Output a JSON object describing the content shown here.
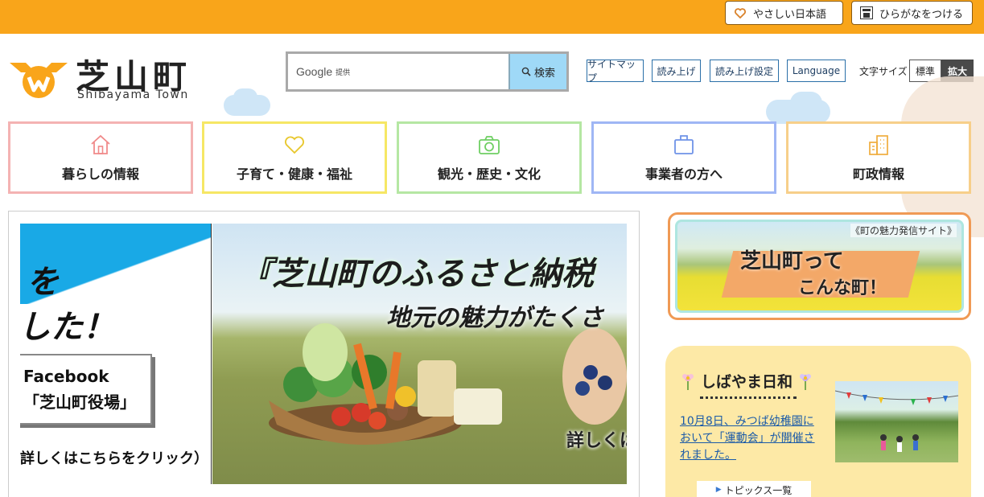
{
  "topbar": {
    "yasashii_label": "やさしい日本語",
    "hiragana_label": "ひらがなをつける",
    "hiragana_icon_text": "ふり\n仮名"
  },
  "header": {
    "logo_title": "芝山町",
    "logo_subtitle": "Shibayama Town",
    "search": {
      "google_label": "Google",
      "provided_label": "提供",
      "button_label": "検索"
    },
    "utility": {
      "sitemap": "サイトマップ",
      "read_aloud": "読み上げ",
      "read_aloud_settings": "読み上げ設定",
      "language": "Language"
    },
    "fontsize": {
      "label": "文字サイズ",
      "standard": "標準",
      "large": "拡大"
    }
  },
  "nav": [
    {
      "label": "暮らしの情報",
      "icon": "house-icon",
      "color": "#f4b3b3"
    },
    {
      "label": "子育て・健康・福祉",
      "icon": "heart-icon",
      "color": "#f6e765"
    },
    {
      "label": "観光・歴史・文化",
      "icon": "camera-icon",
      "color": "#b5e7a3"
    },
    {
      "label": "事業者の方へ",
      "icon": "briefcase-icon",
      "color": "#9fb6f5"
    },
    {
      "label": "町政情報",
      "icon": "building-icon",
      "color": "#f7cf8a"
    }
  ],
  "banner": {
    "left": {
      "line1": "を",
      "line2": "した！",
      "fb_line1": "Facebook",
      "fb_line2": "「芝山町役場」",
      "click_text": "詳しくはこちらをクリック）"
    },
    "right": {
      "title": "『芝山町のふるさと納税",
      "subtitle": "地元の魅力がたくさ",
      "more": "詳しくは"
    }
  },
  "promo": {
    "tag": "《町の魅力発信サイト》",
    "line1": "芝山町って",
    "line2": "こんな町！"
  },
  "news": {
    "title": "しばやま日和",
    "link_text": "10月8日、みつば幼稚園において「運動会」が開催されました。",
    "topics_label": "トピックス一覧"
  },
  "colors": {
    "topbar": "#f9a51a",
    "accent_blue": "#19a9e6",
    "news_bg": "#fde9a6",
    "promo_border": "#f09a55"
  }
}
